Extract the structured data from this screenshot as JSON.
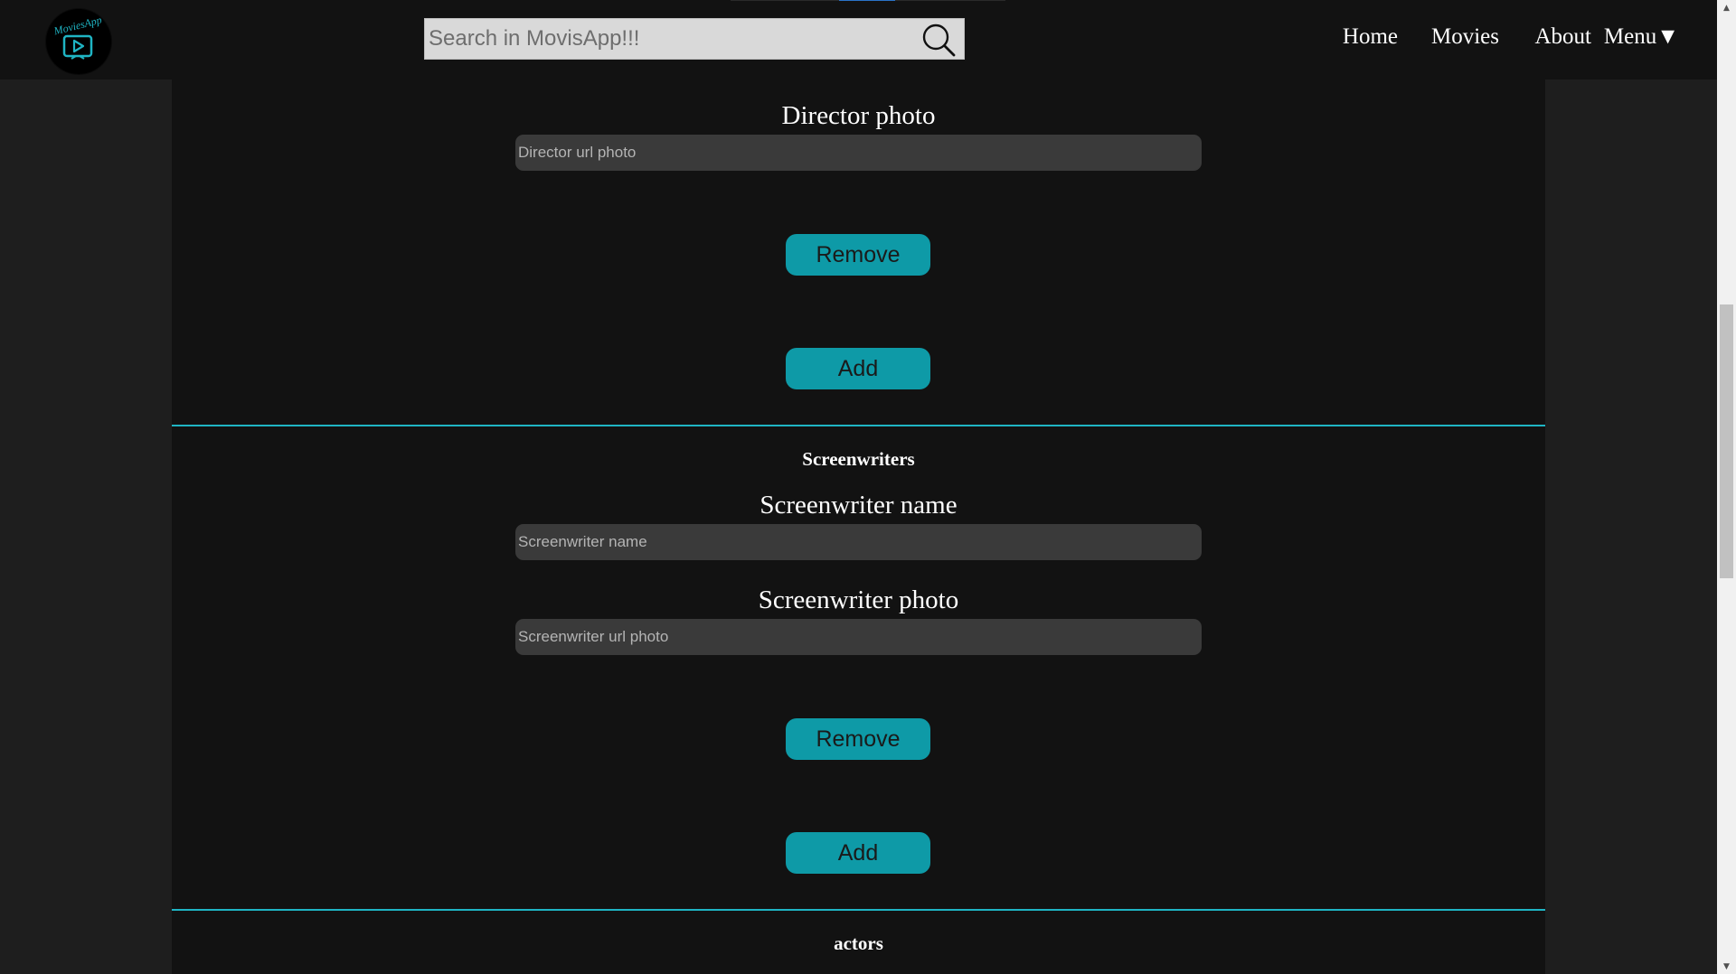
{
  "header": {
    "logo_text": "MoviesApp",
    "search": {
      "placeholder": "Search in MovisApp!!!",
      "value": ""
    },
    "search_icon": "magnifier-icon",
    "nav": [
      {
        "label": "Home"
      },
      {
        "label": "Movies"
      },
      {
        "label": "About"
      },
      {
        "label": "Menu▼"
      }
    ]
  },
  "directors": {
    "photo_label": "Director photo",
    "photo_placeholder": "Director url photo",
    "remove_label": "Remove",
    "add_label": "Add"
  },
  "screenwriters": {
    "title": "Screenwriters",
    "name_label": "Screenwriter name",
    "name_placeholder": "Screenwriter name",
    "photo_label": "Screenwriter photo",
    "photo_placeholder": "Screenwriter url photo",
    "remove_label": "Remove",
    "add_label": "Add"
  },
  "actors": {
    "title": "actors"
  },
  "colors": {
    "accent": "#0e9aa7",
    "divider": "#1fb5c4",
    "background": "#121212",
    "field": "#3a3a3a"
  }
}
